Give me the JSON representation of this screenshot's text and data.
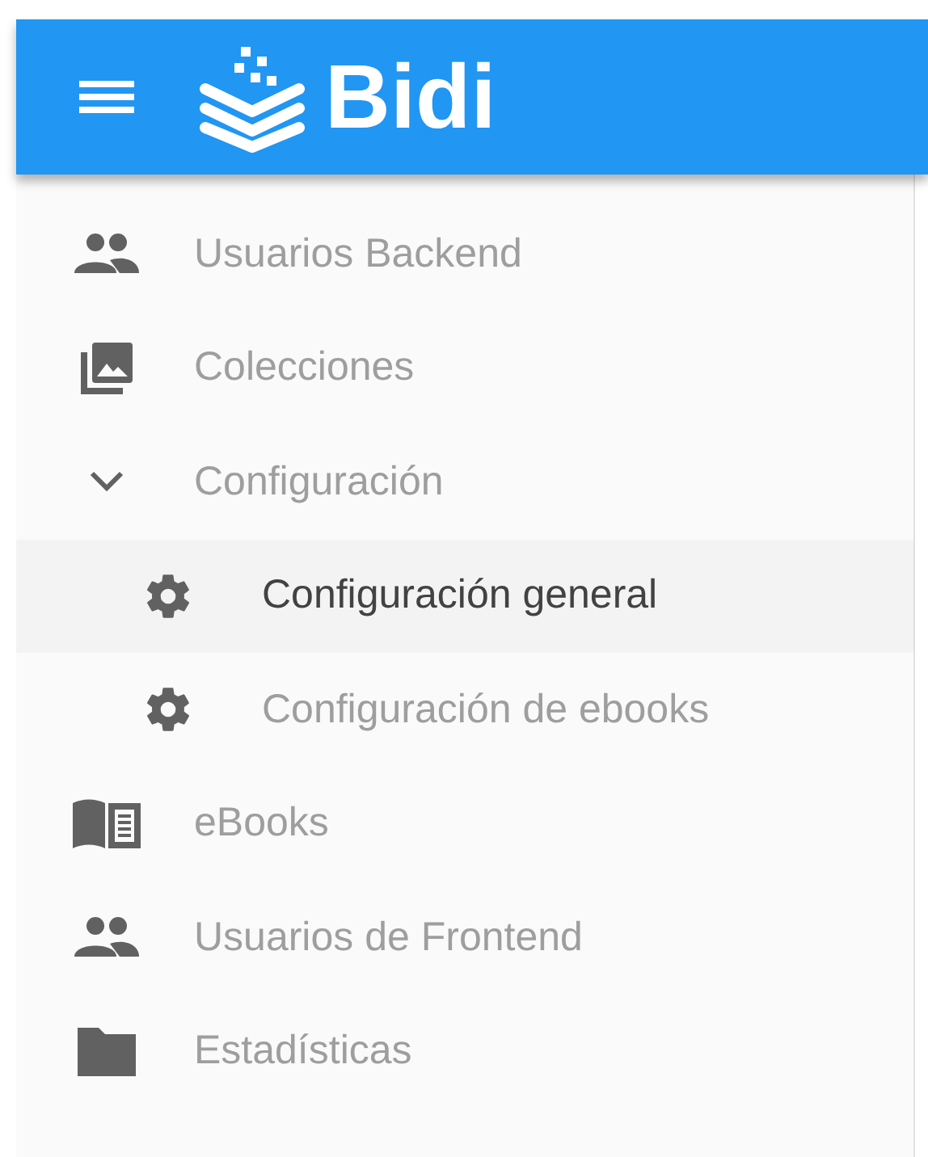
{
  "header": {
    "brand": "Bidi"
  },
  "menu": [
    {
      "kind": "users",
      "label": "Usuarios Backend",
      "selected": false
    },
    {
      "kind": "collections",
      "label": "Colecciones",
      "selected": false
    },
    {
      "kind": "group",
      "label": "Configuración",
      "selected": false,
      "expanded": true,
      "children": [
        {
          "kind": "settings",
          "label": "Configuración general",
          "selected": true
        },
        {
          "kind": "settings",
          "label": "Configuración de ebooks",
          "selected": false
        }
      ]
    },
    {
      "kind": "ebooks",
      "label": "eBooks",
      "selected": false
    },
    {
      "kind": "users",
      "label": "Usuarios de Frontend",
      "selected": false
    },
    {
      "kind": "folder",
      "label": "Estadísticas",
      "selected": false
    }
  ]
}
